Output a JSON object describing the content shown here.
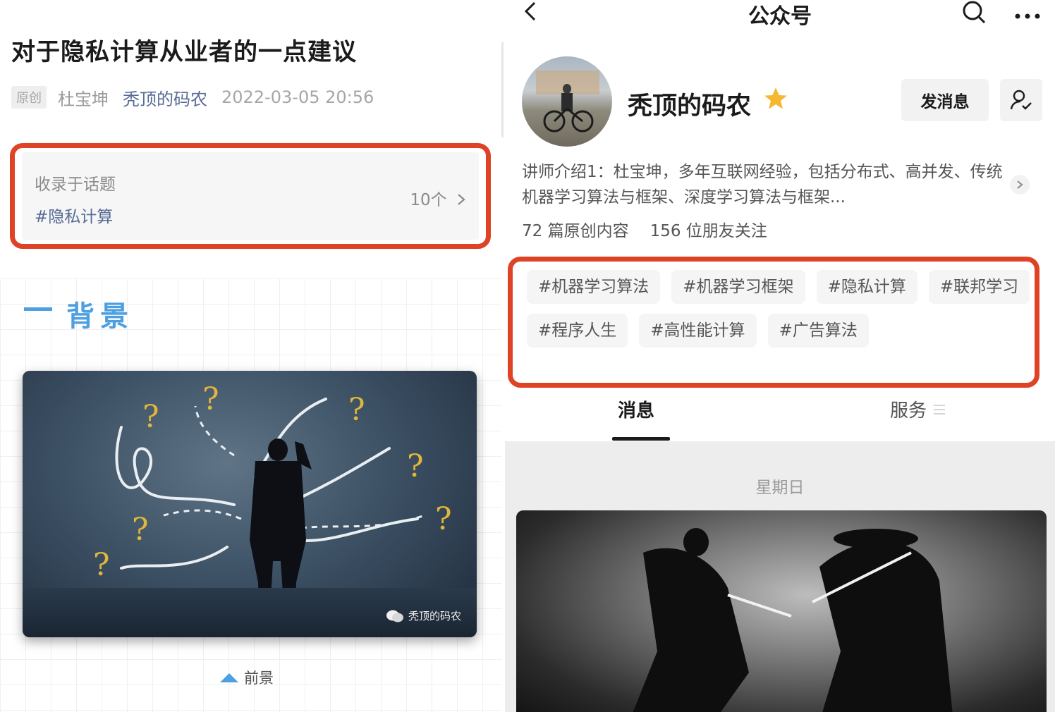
{
  "article": {
    "title": "对于隐私计算从业者的一点建议",
    "badge": "原创",
    "author": "杜宝坤",
    "account": "秃顶的码农",
    "datetime": "2022-03-05 20:56"
  },
  "topic": {
    "heading": "收录于话题",
    "tag": "#隐私计算",
    "count": "10个"
  },
  "section": {
    "title": "背景"
  },
  "image": {
    "watermark": "秃顶的码农",
    "caption": "前景"
  },
  "profile_page": {
    "nav_title": "公众号",
    "name": "秃顶的码农",
    "message_button": "发消息",
    "intro": "讲师介绍1：杜宝坤，多年互联网经验，包括分布式、高并发、传统机器学习算法与框架、深度学习算法与框架...",
    "stats": {
      "articles": "72 篇原创内容",
      "followers": "156 位朋友关注"
    },
    "tags": [
      "#机器学习算法",
      "#机器学习框架",
      "#隐私计算",
      "#联邦学习",
      "#程序人生",
      "#高性能计算",
      "#广告算法"
    ],
    "tabs": [
      "消息",
      "服务"
    ],
    "feed_date": "星期日"
  },
  "colors": {
    "highlight": "#de4326",
    "link": "#576b95",
    "accent": "#4d9fe0",
    "star": "#f5b82e"
  }
}
